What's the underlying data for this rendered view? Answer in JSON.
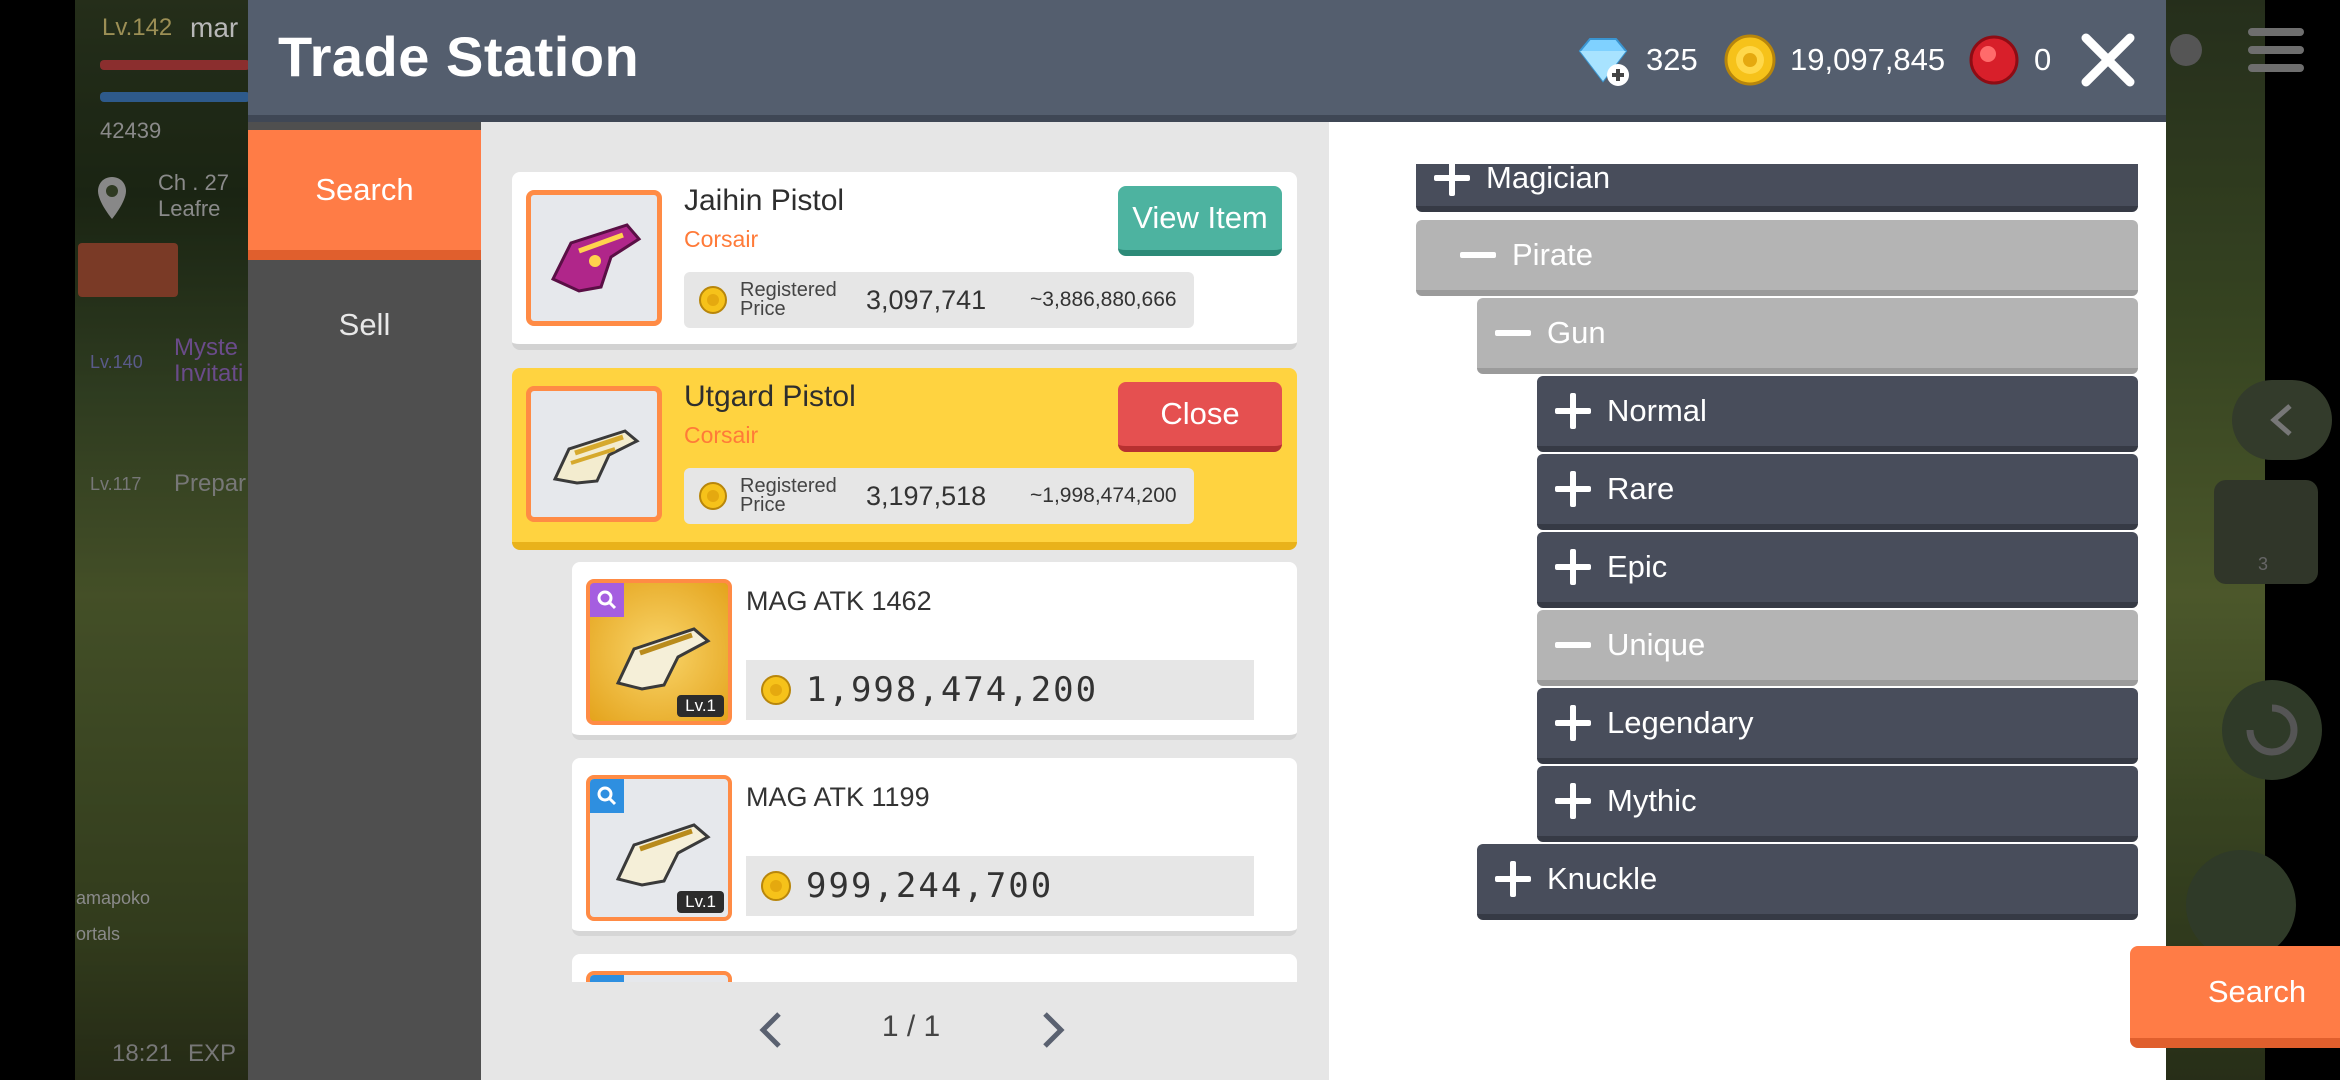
{
  "header": {
    "title": "Trade Station",
    "diamonds": "325",
    "mesos": "19,097,845",
    "red_gems": "0"
  },
  "nav": {
    "search_label": "Search",
    "sell_label": "Sell"
  },
  "listings": [
    {
      "name": "Jaihin Pistol",
      "class": "Corsair",
      "registered_label": "Registered Price",
      "price": "3,097,741",
      "range": "~3,886,880,666",
      "button": "View Item"
    },
    {
      "name": "Utgard Pistol",
      "class": "Corsair",
      "registered_label": "Registered Price",
      "price": "3,197,518",
      "range": "~1,998,474,200",
      "button": "Close"
    }
  ],
  "sub_listings": [
    {
      "stat": "MAG ATK 1462",
      "price": "1,998,474,200",
      "level": "Lv.1"
    },
    {
      "stat": "MAG ATK 1199",
      "price": "999,244,700",
      "level": "Lv.1"
    }
  ],
  "pagination": {
    "label": "1 / 1"
  },
  "tree": {
    "magician": "Magician",
    "pirate": "Pirate",
    "gun": "Gun",
    "normal": "Normal",
    "rare": "Rare",
    "epic": "Epic",
    "unique": "Unique",
    "legendary": "Legendary",
    "mythic": "Mythic",
    "knuckle": "Knuckle"
  },
  "search_button": "Search",
  "hud": {
    "level": "Lv.142",
    "name": "mar",
    "power": "42439",
    "channel": "Ch . 27",
    "location": "Leafre",
    "quest1_level": "Lv.140",
    "quest1": "Myste",
    "quest1_line2": "Invitati",
    "quest2_level": "Lv.117",
    "quest2": "Prepar",
    "time": "18:21",
    "exp": "EXP",
    "player_name": "amapoko",
    "guild": "ortals",
    "badge_count": "3"
  },
  "colors": {
    "header": "#545e6e",
    "accent_orange": "#ff7c46",
    "selected_card": "#ffd340",
    "view_button": "#4db3a0",
    "close_button": "#e55050",
    "tree_dark": "#484d5b",
    "tree_light": "#b4b4b4"
  }
}
